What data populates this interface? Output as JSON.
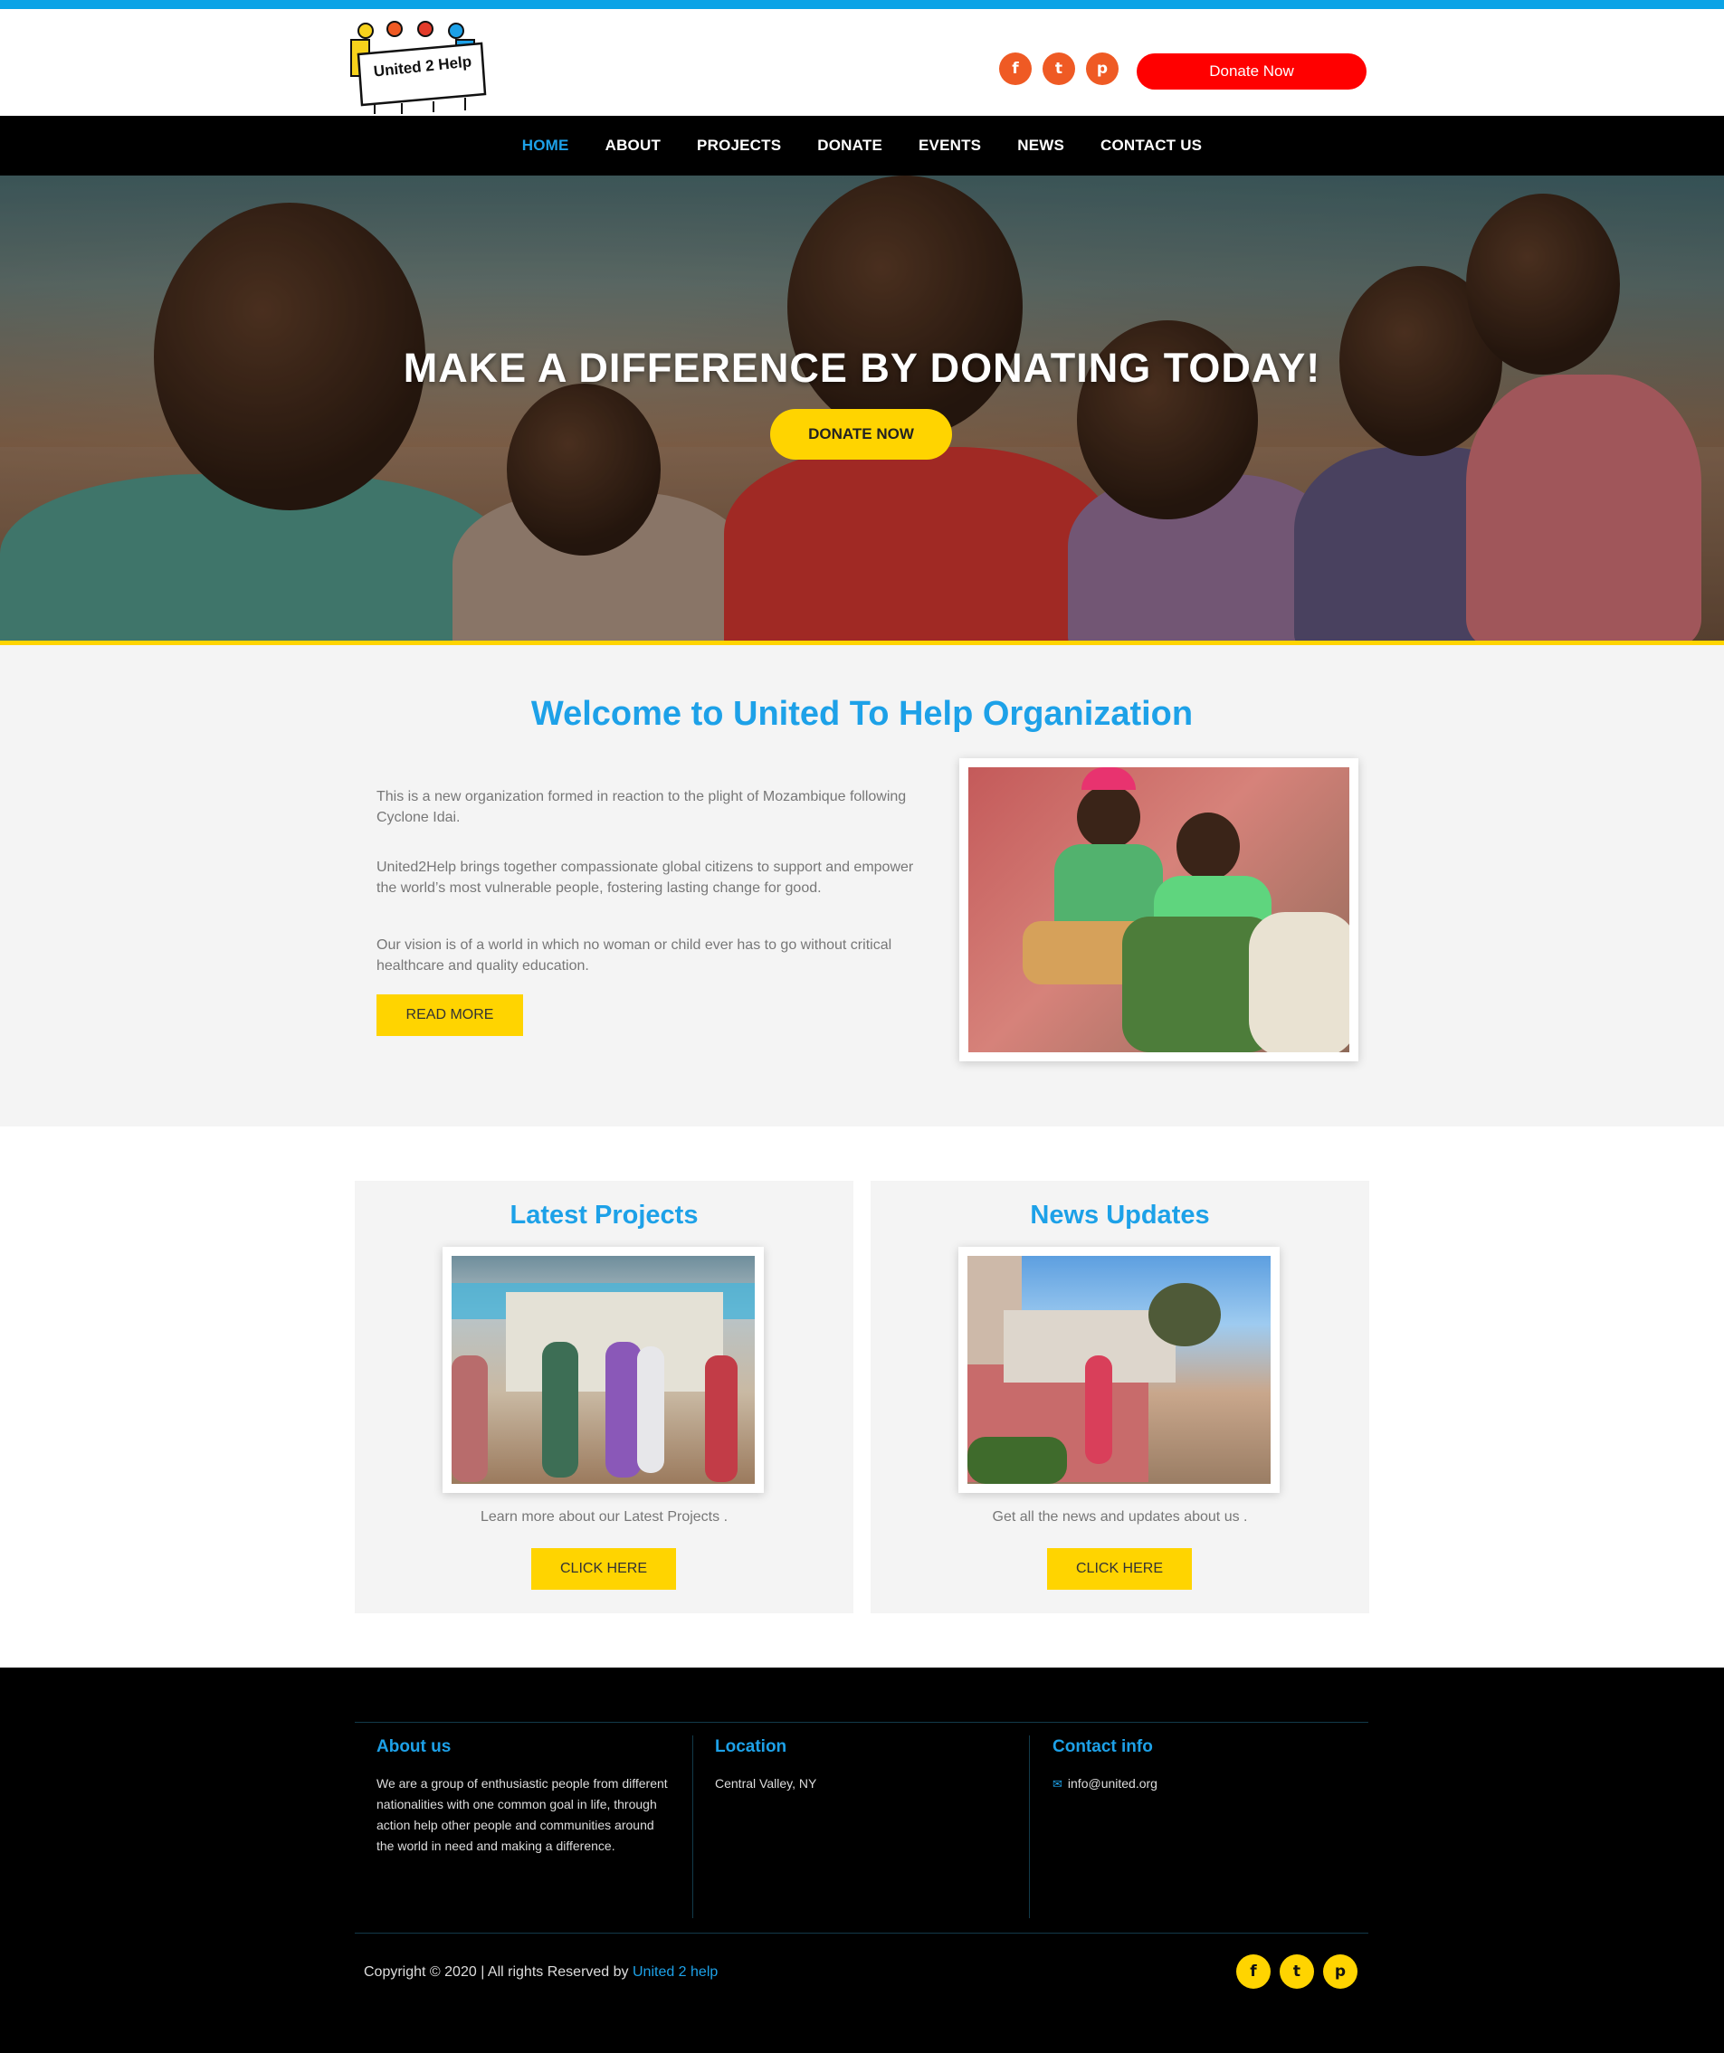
{
  "header": {
    "logo_text": "United 2 Help",
    "donate_label": "Donate Now",
    "social": [
      {
        "icon": "facebook-icon",
        "glyph": "f"
      },
      {
        "icon": "twitter-icon",
        "glyph": "t"
      },
      {
        "icon": "pinterest-icon",
        "glyph": "p"
      }
    ]
  },
  "nav": {
    "items": [
      "HOME",
      "ABOUT",
      "PROJECTS",
      "DONATE",
      "EVENTS",
      "NEWS",
      "CONTACT US"
    ],
    "active": "HOME"
  },
  "hero": {
    "title": "MAKE A DIFFERENCE BY DONATING TODAY!",
    "button": "DONATE NOW"
  },
  "welcome": {
    "title": "Welcome to United To Help Organization",
    "paragraphs": [
      "This is a new organization formed in reaction to the plight of Mozambique following Cyclone Idai.",
      "United2Help brings together compassionate global citizens to support and empower the world’s most vulnerable people, fostering lasting change for good.",
      "Our vision is of a world in which no woman or child ever has to go without critical healthcare and quality education."
    ],
    "button": "READ MORE"
  },
  "cards": [
    {
      "title": "Latest Projects",
      "text": "Learn more about our Latest Projects .",
      "button": "CLICK HERE"
    },
    {
      "title": "News Updates",
      "text": "Get all the news and updates about us .",
      "button": "CLICK HERE"
    }
  ],
  "footer": {
    "about": {
      "title": "About us",
      "text": "We are a group of enthusiastic people from different nationalities with one common goal in life, through action help other people and communities around the world in need and making a difference."
    },
    "location": {
      "title": "Location",
      "text": "Central Valley, NY"
    },
    "contact": {
      "title": "Contact info",
      "email": "info@united.org"
    },
    "copyright": "Copyright © 2020 | All rights Reserved by",
    "brand": "United 2 help"
  },
  "colors": {
    "accent_blue": "#1da1e8",
    "yellow": "#ffd400",
    "red": "#ff0000",
    "orange": "#ef5a24"
  }
}
